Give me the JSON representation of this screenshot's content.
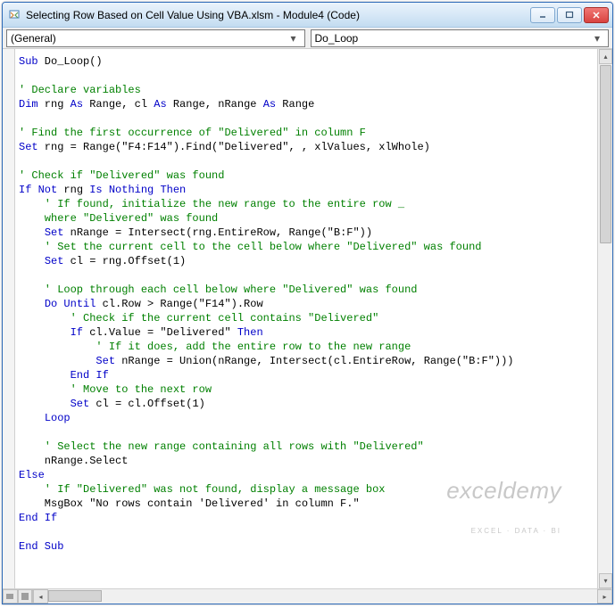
{
  "window": {
    "title": "Selecting Row Based on Cell Value Using VBA.xlsm - Module4 (Code)"
  },
  "dropdowns": {
    "left": "(General)",
    "right": "Do_Loop"
  },
  "code": {
    "line01a": "Sub",
    "line01b": " Do_Loop()",
    "line03": "' Declare variables",
    "line04a": "Dim",
    "line04b": " rng ",
    "line04c": "As",
    "line04d": " Range, cl ",
    "line04e": "As",
    "line04f": " Range, nRange ",
    "line04g": "As",
    "line04h": " Range",
    "line06": "' Find the first occurrence of \"Delivered\" in column F",
    "line07a": "Set",
    "line07b": " rng = Range(\"F4:F14\").Find(\"Delivered\", , xlValues, xlWhole)",
    "line09": "' Check if \"Delivered\" was found",
    "line10a": "If Not",
    "line10b": " rng ",
    "line10c": "Is Nothing Then",
    "line11": "    ' If found, initialize the new range to the entire row _",
    "line12": "    where \"Delivered\" was found",
    "line13a": "    ",
    "line13b": "Set",
    "line13c": " nRange = Intersect(rng.EntireRow, Range(\"B:F\"))",
    "line14": "    ' Set the current cell to the cell below where \"Delivered\" was found",
    "line15a": "    ",
    "line15b": "Set",
    "line15c": " cl = rng.Offset(1)",
    "line17": "    ' Loop through each cell below where \"Delivered\" was found",
    "line18a": "    ",
    "line18b": "Do Until",
    "line18c": " cl.Row > Range(\"F14\").Row",
    "line19": "        ' Check if the current cell contains \"Delivered\"",
    "line20a": "        ",
    "line20b": "If",
    "line20c": " cl.Value = \"Delivered\" ",
    "line20d": "Then",
    "line21": "            ' If it does, add the entire row to the new range",
    "line22a": "            ",
    "line22b": "Set",
    "line22c": " nRange = Union(nRange, Intersect(cl.EntireRow, Range(\"B:F\")))",
    "line23a": "        ",
    "line23b": "End If",
    "line24": "        ' Move to the next row",
    "line25a": "        ",
    "line25b": "Set",
    "line25c": " cl = cl.Offset(1)",
    "line26a": "    ",
    "line26b": "Loop",
    "line28": "    ' Select the new range containing all rows with \"Delivered\"",
    "line29": "    nRange.Select",
    "line30": "Else",
    "line31": "    ' If \"Delivered\" was not found, display a message box",
    "line32": "    MsgBox \"No rows contain 'Delivered' in column F.\"",
    "line33": "End If",
    "line35": "End Sub"
  },
  "watermark": {
    "main": "exceldemy",
    "sub": "EXCEL · DATA · BI"
  }
}
